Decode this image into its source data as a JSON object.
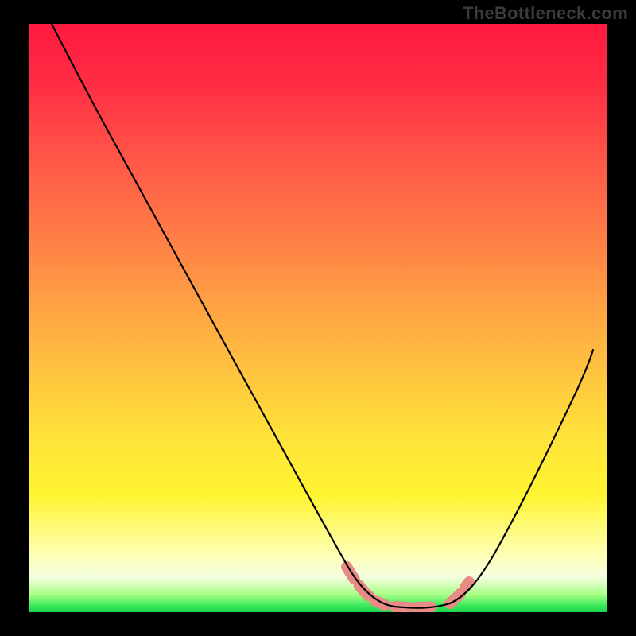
{
  "watermark": "TheBottleneck.com",
  "chart_data": {
    "type": "line",
    "title": "",
    "xlabel": "",
    "ylabel": "",
    "xlim": [
      0,
      100
    ],
    "ylim": [
      0,
      100
    ],
    "grid": false,
    "annotations": [],
    "series": [
      {
        "name": "curve",
        "color": "#000000",
        "x": [
          4,
          10,
          20,
          30,
          40,
          50,
          55,
          60,
          62,
          67,
          72,
          76,
          80,
          85,
          90,
          97
        ],
        "values": [
          100,
          89,
          71,
          53,
          35,
          17,
          8,
          3,
          1,
          1,
          1,
          5,
          12,
          24,
          37,
          55
        ]
      },
      {
        "name": "highlight-segments",
        "color": "#e88a86",
        "xranges": [
          [
            55,
            62
          ],
          [
            63,
            72
          ],
          [
            73,
            77
          ]
        ],
        "note": "dashed thick segments near curve minimum"
      }
    ]
  },
  "colors": {
    "gradient_top": "#ff1a3f",
    "gradient_mid": "#ffe23a",
    "gradient_bottom": "#1ed24e",
    "highlight": "#e88a86",
    "curve": "#000000",
    "frame": "#000000",
    "watermark": "#3b3b3b"
  }
}
